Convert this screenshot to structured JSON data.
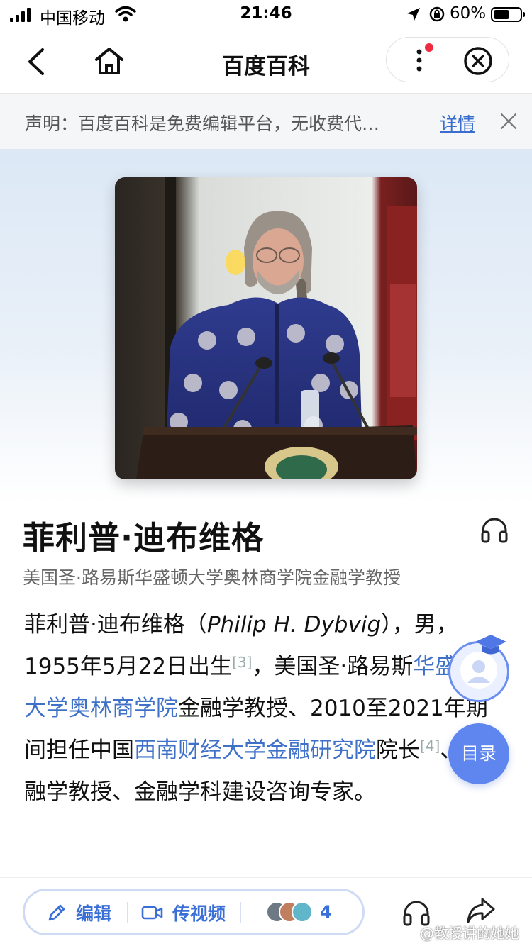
{
  "status_bar": {
    "carrier": "中国移动",
    "time": "21:46",
    "battery_percent_text": "60%",
    "battery_level": 0.6
  },
  "nav": {
    "title": "百度百科",
    "icons": [
      "back-arrow-icon",
      "home-icon",
      "more-dots-icon",
      "close-circle-icon"
    ]
  },
  "notice": {
    "text": "声明：百度百科是免费编辑平台，无收费代…",
    "link": "详情"
  },
  "entry": {
    "name": "菲利普·迪布维格",
    "summary": "美国圣·路易斯华盛顿大学奥林商学院金融学教授",
    "body": {
      "p1": "菲利普·迪布维格（",
      "english_name": "Philip H. Dybvig",
      "p2": "），男，1955年5月22日出生",
      "ref1": "[3]",
      "p3": "，美国圣·路易斯",
      "link1": "华盛顿大学奥林商学院",
      "p4": "金融学教授、2010至2021年期间担任中国",
      "link2": "西南财经大学金融研究院",
      "p5": "院长",
      "ref2": "[4]",
      "p6": "、金融学教授、金融学科建设咨询专家。"
    }
  },
  "floating": {
    "toc_label": "目录"
  },
  "bottom_bar": {
    "edit_label": "编辑",
    "video_label": "传视频",
    "contributors_count": "4"
  },
  "watermark": "@教授讲的她她"
}
